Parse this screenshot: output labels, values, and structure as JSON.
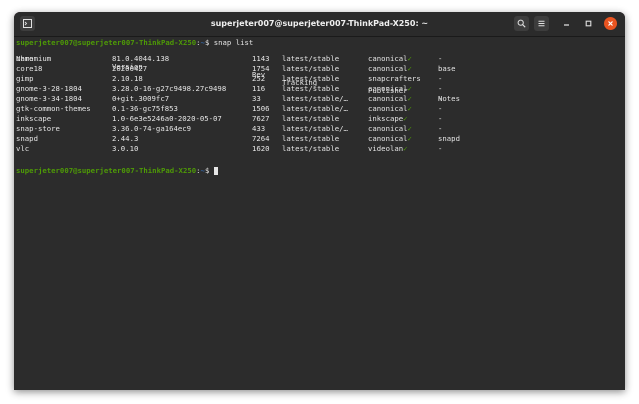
{
  "window": {
    "title": "superjeter007@superjeter007-ThinkPad-X250: ~"
  },
  "terminal": {
    "prompt_user": "superjeter007@superjeter007-ThinkPad-X250",
    "prompt_sep": ":",
    "prompt_path": "~",
    "prompt_symbol": "$",
    "command": "snap list",
    "headers": {
      "name": "Name",
      "version": "Version",
      "rev": "Rev",
      "tracking": "Tracking",
      "publisher": "Publisher",
      "notes": "Notes"
    },
    "rows": [
      {
        "name": "chromium",
        "version": "81.0.4044.138",
        "rev": "1143",
        "tracking": "latest/stable",
        "publisher": "canonical",
        "check": "✓",
        "notes": "-"
      },
      {
        "name": "core18",
        "version": "20200427",
        "rev": "1754",
        "tracking": "latest/stable",
        "publisher": "canonical",
        "check": "✓",
        "notes": "base"
      },
      {
        "name": "gimp",
        "version": "2.10.18",
        "rev": "252",
        "tracking": "latest/stable",
        "publisher": "snapcrafters",
        "check": "",
        "notes": "-"
      },
      {
        "name": "gnome-3-28-1804",
        "version": "3.28.0-16-g27c9498.27c9498",
        "rev": "116",
        "tracking": "latest/stable",
        "publisher": "canonical",
        "check": "✓",
        "notes": "-"
      },
      {
        "name": "gnome-3-34-1804",
        "version": "0+git.3009fc7",
        "rev": "33",
        "tracking": "latest/stable/…",
        "publisher": "canonical",
        "check": "✓",
        "notes": "-"
      },
      {
        "name": "gtk-common-themes",
        "version": "0.1-36-gc75f853",
        "rev": "1506",
        "tracking": "latest/stable/…",
        "publisher": "canonical",
        "check": "✓",
        "notes": "-"
      },
      {
        "name": "inkscape",
        "version": "1.0-6e3e5246a0-2020-05-07",
        "rev": "7627",
        "tracking": "latest/stable",
        "publisher": "inkscape",
        "check": "✓",
        "notes": "-"
      },
      {
        "name": "snap-store",
        "version": "3.36.0-74-ga164ec9",
        "rev": "433",
        "tracking": "latest/stable/…",
        "publisher": "canonical",
        "check": "✓",
        "notes": "-"
      },
      {
        "name": "snapd",
        "version": "2.44.3",
        "rev": "7264",
        "tracking": "latest/stable",
        "publisher": "canonical",
        "check": "✓",
        "notes": "snapd"
      },
      {
        "name": "vlc",
        "version": "3.0.10",
        "rev": "1620",
        "tracking": "latest/stable",
        "publisher": "videolan",
        "check": "✓",
        "notes": "-"
      }
    ]
  },
  "colors": {
    "prompt_user": "#4e9a06",
    "prompt_path": "#3465a4",
    "accent_close": "#e95420",
    "terminal_bg": "#2c2c2c"
  },
  "icons": {
    "new_tab": "terminal-icon",
    "search": "search-icon",
    "menu": "hamburger-menu-icon",
    "minimize": "minimize-icon",
    "maximize": "maximize-icon",
    "close": "close-icon"
  }
}
